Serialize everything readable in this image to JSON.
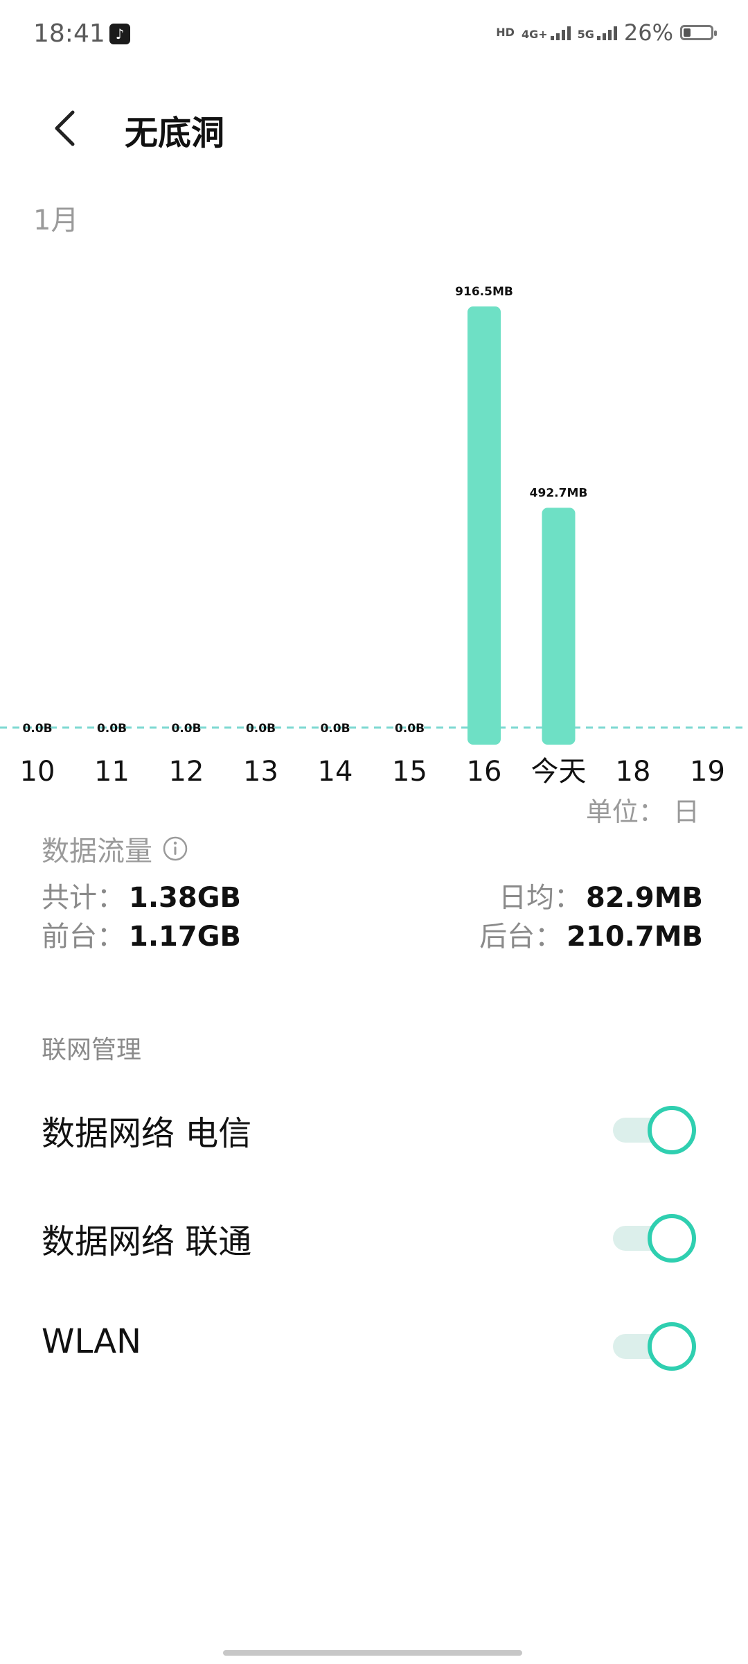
{
  "status_bar": {
    "time": "18:41",
    "hd_label": "HD",
    "sim1_network": "4G+",
    "sim2_network": "5G",
    "battery": "26%",
    "battery_level": 0.26
  },
  "header": {
    "back_icon": "chevron-left-icon",
    "title": "无底洞"
  },
  "month_label": "1月",
  "chart_data": {
    "type": "bar",
    "categories": [
      "10",
      "11",
      "12",
      "13",
      "14",
      "15",
      "16",
      "今天",
      "18",
      "19"
    ],
    "values_mb": [
      0,
      0,
      0,
      0,
      0,
      0,
      916.5,
      492.7,
      null,
      null
    ],
    "data_labels": [
      "0.0B",
      "0.0B",
      "0.0B",
      "0.0B",
      "0.0B",
      "0.0B",
      "916.5MB",
      "492.7MB",
      "",
      ""
    ],
    "average_line_mb": 82.9,
    "bar_color": "#6ee0c5",
    "average_line_color": "#7dd8d1",
    "unit_label": "单位： 日"
  },
  "data_usage": {
    "section_title": "数据流量",
    "total_label": "共计：",
    "total_value": "1.38GB",
    "daily_avg_label": "日均：",
    "daily_avg_value": "82.9MB",
    "foreground_label": "前台：",
    "foreground_value": "1.17GB",
    "background_label": "后台：",
    "background_value": "210.7MB"
  },
  "network_management": {
    "section_title": "联网管理",
    "rows": [
      {
        "label": "数据网络 电信",
        "enabled": true
      },
      {
        "label": "数据网络 联通",
        "enabled": true
      },
      {
        "label": "WLAN",
        "enabled": true
      }
    ],
    "accent_color": "#2fcfb0"
  }
}
